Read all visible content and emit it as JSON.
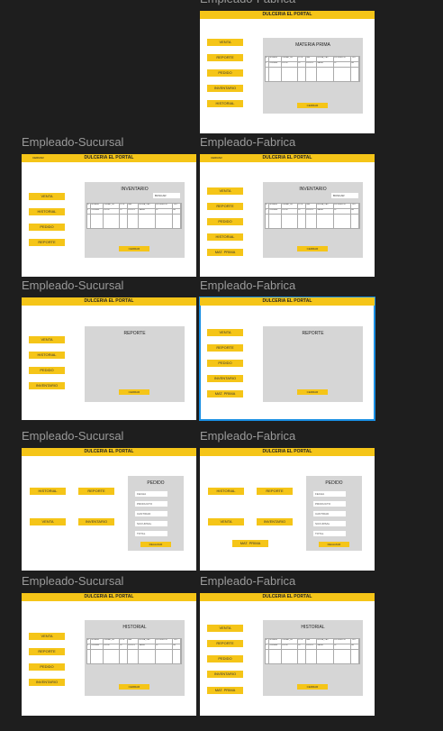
{
  "app_title": "DULCERIA EL PORTAL",
  "labels": {
    "sucursal": "Empleado-Sucursal",
    "fabrica": "Empleado-Fabrica"
  },
  "cerrar": "CERRAR",
  "nav": {
    "venta": "VENTA",
    "reporte": "REPORTE",
    "pedido": "PEDIDO",
    "inventario": "INVENTARIO",
    "historial": "HISTORIAL",
    "mat_prima": "MAT. PRIMA"
  },
  "panels": {
    "materia_prima": "MATERIA PRIMA",
    "inventario": "INVENTARIO",
    "reporte": "REPORTE",
    "pedido": "PEDIDO",
    "historial": "HISTORIAL"
  },
  "search": {
    "label": "BUSCAR"
  },
  "table": {
    "headers": [
      "ID",
      "NOMBRE",
      "UNIDAD_DE",
      "LOTE",
      "CAN",
      "FECHA_CAD",
      "PROVEEDOR",
      "TIPO"
    ],
    "row": [
      "1",
      "Chocolate",
      "$70.00",
      "50",
      "21/02/23",
      "NA/NA",
      "10",
      "Ali"
    ]
  },
  "pedido_form": {
    "fields": [
      "FECHA",
      "PRODUCTO",
      "CANTIDAD",
      "SUCURSAL",
      "TOTAL"
    ],
    "submit": "REALIZAR"
  }
}
